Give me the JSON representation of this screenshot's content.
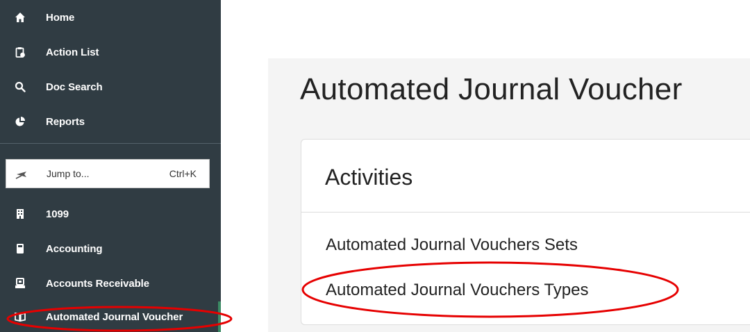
{
  "sidebar": {
    "items": [
      {
        "label": "Home",
        "icon": "home-icon"
      },
      {
        "label": "Action List",
        "icon": "clipboard-icon"
      },
      {
        "label": "Doc Search",
        "icon": "search-icon"
      },
      {
        "label": "Reports",
        "icon": "pie-chart-icon"
      },
      {
        "label": "1099",
        "icon": "building-icon"
      },
      {
        "label": "Accounting",
        "icon": "calculator-icon"
      },
      {
        "label": "Accounts Receivable",
        "icon": "cash-register-icon"
      },
      {
        "label": "Automated Journal Voucher",
        "icon": "open-book-icon"
      }
    ],
    "jump": {
      "label": "Jump to...",
      "shortcut": "Ctrl+K",
      "icon": "plane-icon"
    }
  },
  "main": {
    "title": "Automated Journal Voucher",
    "card": {
      "title": "Activities",
      "links": [
        {
          "label": "Automated Journal Vouchers Sets"
        },
        {
          "label": "Automated Journal Vouchers Types"
        }
      ]
    }
  },
  "colors": {
    "sidebar_bg": "#303c43",
    "sidebar_text": "#ffffff",
    "main_bg": "#f4f4f4",
    "annotation": "#e60000"
  }
}
